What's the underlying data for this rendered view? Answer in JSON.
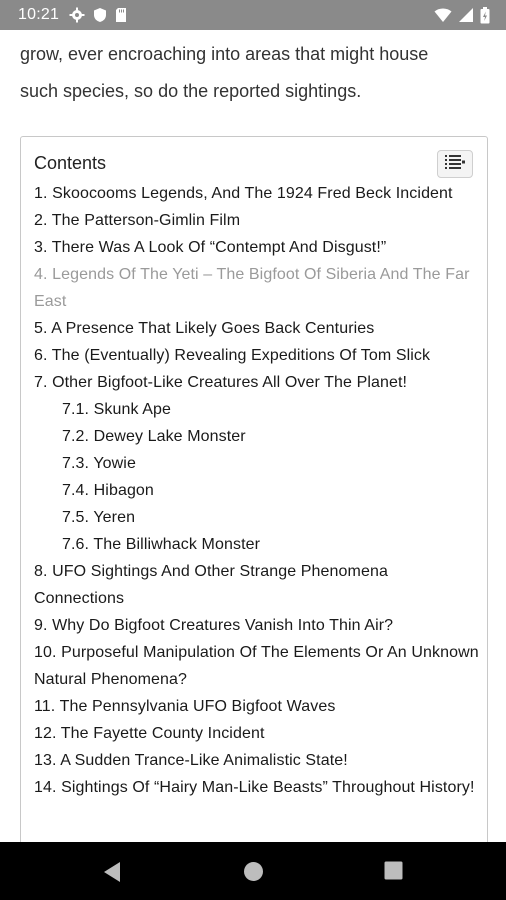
{
  "status_bar": {
    "time": "10:21",
    "left_icons": [
      "gear-icon",
      "shield-icon",
      "sd-card-icon"
    ],
    "right_icons": [
      "wifi-icon",
      "signal-icon",
      "battery-icon"
    ]
  },
  "article": {
    "intro_line1": "grow, ever encroaching into areas that might house",
    "intro_line2": "such species, so do the reported sightings."
  },
  "toc": {
    "title": "Contents",
    "toggle_icon": "list-toggle-icon",
    "items": [
      {
        "text": "1. Skoocooms Legends, And The 1924 Fred Beck Incident"
      },
      {
        "text": "2. The Patterson-Gimlin Film"
      },
      {
        "text": "3. There Was A Look Of “Contempt And Disgust!”"
      },
      {
        "text": "4. Legends Of The Yeti – The Bigfoot Of Siberia And The Far East"
      },
      {
        "text": "5. A Presence That Likely Goes Back Centuries"
      },
      {
        "text": "6. The (Eventually) Revealing Expeditions Of Tom Slick"
      },
      {
        "text": "7. Other Bigfoot-Like Creatures All Over The Planet!"
      },
      {
        "text": "7.1. Skunk Ape"
      },
      {
        "text": "7.2. Dewey Lake Monster"
      },
      {
        "text": "7.3. Yowie"
      },
      {
        "text": "7.4. Hibagon"
      },
      {
        "text": "7.5. Yeren"
      },
      {
        "text": "7.6. The Billiwhack Monster"
      },
      {
        "text": "8. UFO Sightings And Other Strange Phenomena Connections"
      },
      {
        "text": "9. Why Do Bigfoot Creatures Vanish Into Thin Air?"
      },
      {
        "text": "10. Purposeful Manipulation Of The Elements Or An Unknown Natural Phenomena?"
      },
      {
        "text": "11. The Pennsylvania UFO Bigfoot Waves"
      },
      {
        "text": "12. The Fayette County Incident"
      },
      {
        "text": "13. A Sudden Trance-Like Animalistic State!"
      },
      {
        "text": "14. Sightings Of “Hairy Man-Like Beasts” Throughout History!"
      }
    ]
  },
  "nav_bar": {
    "buttons": [
      "back-icon",
      "home-icon",
      "recents-icon"
    ]
  },
  "colors": {
    "status_bar": "#8a8a8a",
    "nav_bar": "#000000",
    "dimmed_item": "#9a9a9a",
    "text": "#1a1a1a"
  }
}
